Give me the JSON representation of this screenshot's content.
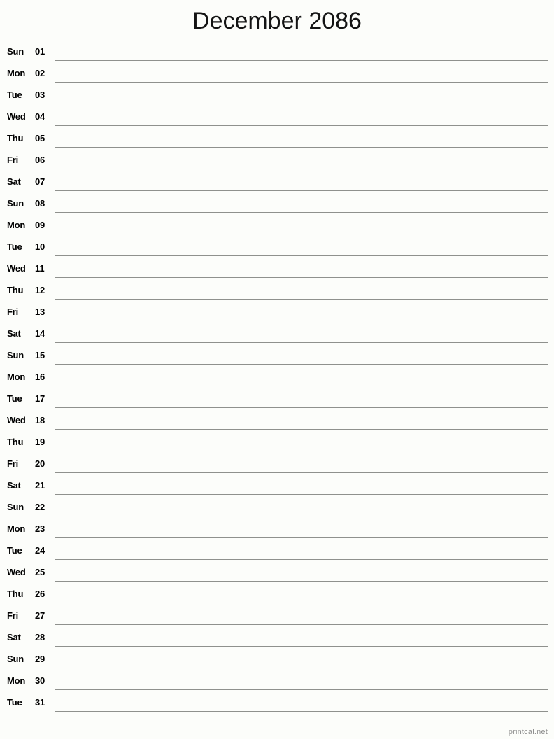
{
  "title": "December 2086",
  "month": "December",
  "year": "2086",
  "footer": {
    "watermark": "printcal.net"
  },
  "colors": {
    "background": "#fcfdfa",
    "title_text": "#141414",
    "row_text": "#000000",
    "rule_line": "#8f918d",
    "watermark_text": "#8d8d8d"
  },
  "rows": [
    {
      "weekday": "Sun",
      "date": "01"
    },
    {
      "weekday": "Mon",
      "date": "02"
    },
    {
      "weekday": "Tue",
      "date": "03"
    },
    {
      "weekday": "Wed",
      "date": "04"
    },
    {
      "weekday": "Thu",
      "date": "05"
    },
    {
      "weekday": "Fri",
      "date": "06"
    },
    {
      "weekday": "Sat",
      "date": "07"
    },
    {
      "weekday": "Sun",
      "date": "08"
    },
    {
      "weekday": "Mon",
      "date": "09"
    },
    {
      "weekday": "Tue",
      "date": "10"
    },
    {
      "weekday": "Wed",
      "date": "11"
    },
    {
      "weekday": "Thu",
      "date": "12"
    },
    {
      "weekday": "Fri",
      "date": "13"
    },
    {
      "weekday": "Sat",
      "date": "14"
    },
    {
      "weekday": "Sun",
      "date": "15"
    },
    {
      "weekday": "Mon",
      "date": "16"
    },
    {
      "weekday": "Tue",
      "date": "17"
    },
    {
      "weekday": "Wed",
      "date": "18"
    },
    {
      "weekday": "Thu",
      "date": "19"
    },
    {
      "weekday": "Fri",
      "date": "20"
    },
    {
      "weekday": "Sat",
      "date": "21"
    },
    {
      "weekday": "Sun",
      "date": "22"
    },
    {
      "weekday": "Mon",
      "date": "23"
    },
    {
      "weekday": "Tue",
      "date": "24"
    },
    {
      "weekday": "Wed",
      "date": "25"
    },
    {
      "weekday": "Thu",
      "date": "26"
    },
    {
      "weekday": "Fri",
      "date": "27"
    },
    {
      "weekday": "Sat",
      "date": "28"
    },
    {
      "weekday": "Sun",
      "date": "29"
    },
    {
      "weekday": "Mon",
      "date": "30"
    },
    {
      "weekday": "Tue",
      "date": "31"
    }
  ]
}
